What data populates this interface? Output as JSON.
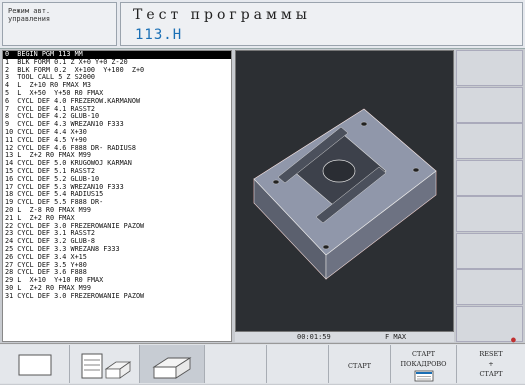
{
  "header": {
    "mode_label": "Режим авт.\nуправления",
    "title": "Тест программы",
    "file_name": "113.H"
  },
  "program": {
    "lines": [
      "0  BEGIN PGM 113 MM",
      "1  BLK FORM 0.1 Z X+0 Y+0 Z-20",
      "2  BLK FORM 0.2  X+100  Y+100  Z+0",
      "3  TOOL CALL 5 Z S2000",
      "4  L  Z+10 R0 FMAX M3",
      "5  L  X+50  Y+50 R0 FMAX",
      "6  CYCL DEF 4.0 FREZEROW.KARMANOW",
      "7  CYCL DEF 4.1 RASST2",
      "8  CYCL DEF 4.2 GLUB-10",
      "9  CYCL DEF 4.3 WREZAN10 F333",
      "10 CYCL DEF 4.4 X+30",
      "11 CYCL DEF 4.5 Y+90",
      "12 CYCL DEF 4.6 F888 DR- RADIUS8",
      "13 L  Z+2 R0 FMAX M99",
      "14 CYCL DEF 5.0 KRUGOWOJ KARMAN",
      "15 CYCL DEF 5.1 RASST2",
      "16 CYCL DEF 5.2 GLUB-10",
      "17 CYCL DEF 5.3 WREZAN10 F333",
      "18 CYCL DEF 5.4 RADIUS15",
      "19 CYCL DEF 5.5 F888 DR-",
      "20 L  Z-8 R0 FMAX M99",
      "21 L  Z+2 R0 FMAX",
      "22 CYCL DEF 3.0 FREZEROWANIE PAZOW",
      "23 CYCL DEF 3.1 RASST2",
      "24 CYCL DEF 3.2 GLUB-8",
      "25 CYCL DEF 3.3 WREZAN8 F333",
      "26 CYCL DEF 3.4 X+15",
      "27 CYCL DEF 3.5 Y+80",
      "28 CYCL DEF 3.6 F888",
      "29 L  X+10  Y+10 R0 FMAX",
      "30 L  Z+2 R0 FMAX M99",
      "31 CYCL DEF 3.0 FREZEROWANIE PAZOW"
    ]
  },
  "status": {
    "time": "00:01:59",
    "feed": "F MAX"
  },
  "softkeys": {
    "start": "СТАРТ",
    "start_block_1": "СТАРТ",
    "start_block_2": "ПОКАДРОВО",
    "reset_1": "RESET",
    "reset_2": "+",
    "reset_3": "СТАРТ"
  },
  "colors": {
    "highlight": "#000000",
    "file_name": "#1a6fb5",
    "workpiece": "#8e94a8",
    "blank_edges": "#d02020"
  }
}
